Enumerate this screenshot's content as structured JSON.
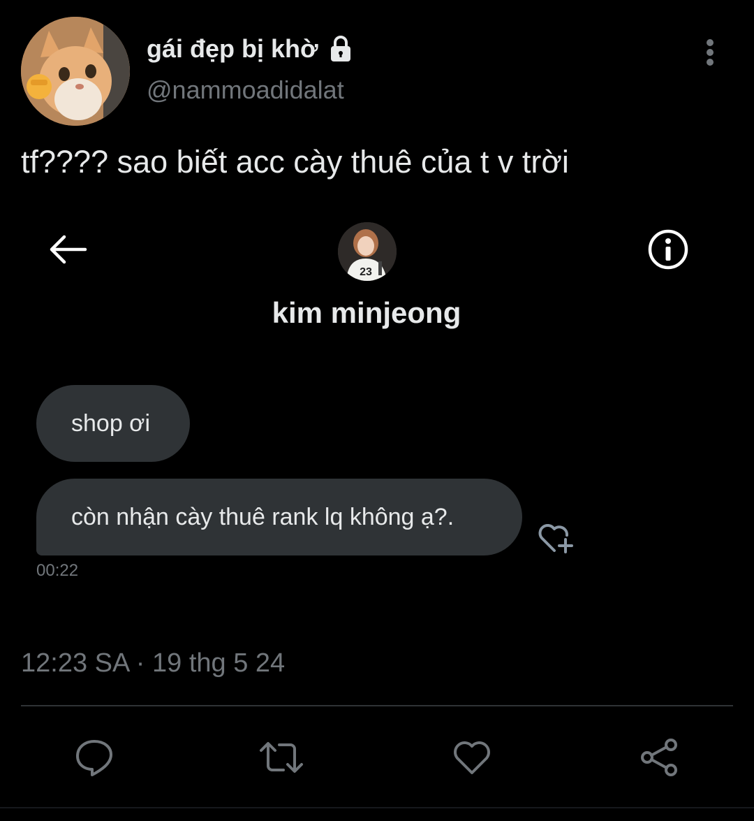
{
  "author": {
    "display_name": "gái đẹp bị khờ",
    "handle": "@nammoadidalat",
    "avatar_icon": "cat-avatar",
    "lock_icon": "lock-icon"
  },
  "tweet": {
    "text": "tf???? sao biết acc cày thuê của t v trời",
    "meta": "12:23 SA · 19 thg 5 24"
  },
  "dm_screenshot": {
    "contact_name": "kim minjeong",
    "contact_avatar_jersey": "23",
    "messages": [
      {
        "text": "shop ơi"
      },
      {
        "text": "còn nhận cày thuê rank lq không ạ?."
      }
    ],
    "message_time": "00:22"
  },
  "actions": {
    "reply_icon": "reply-icon",
    "retweet_icon": "retweet-icon",
    "like_icon": "heart-icon",
    "share_icon": "share-icon"
  },
  "colors": {
    "background": "#000000",
    "text_primary": "#e7e9ea",
    "text_secondary": "#71767b",
    "bubble": "#2f3336"
  }
}
